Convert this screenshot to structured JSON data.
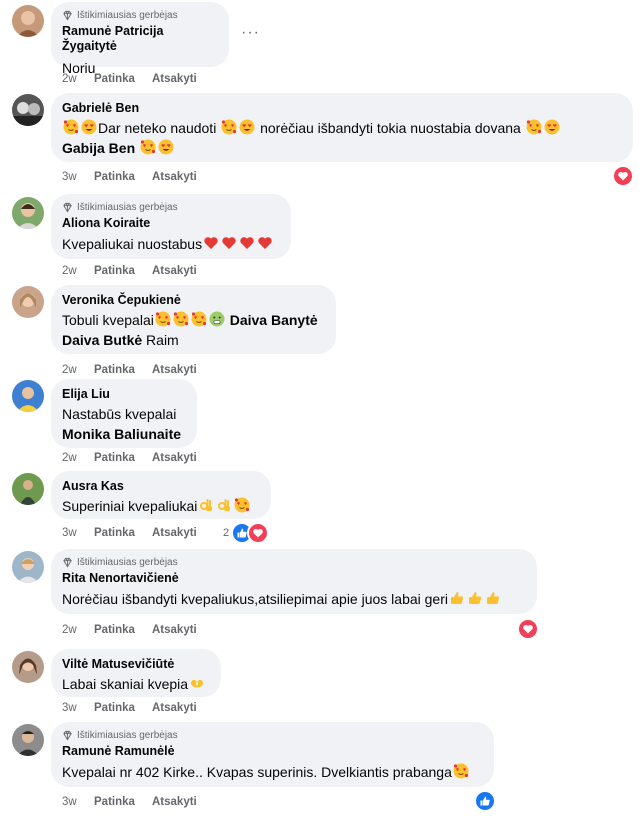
{
  "badge_label": "Ištikimiausias gerbėjas",
  "action_like": "Patinka",
  "action_reply": "Atsakyti",
  "more_icon": "···",
  "comments": [
    {
      "author": "Ramunė Patricija Žygaitytė",
      "badge": true,
      "line1": "Noriu",
      "time": "2w"
    },
    {
      "author": "Gabrielė Ben",
      "badge": false,
      "line1": "Dar neteko naudoti",
      "line1b": "norėčiau išbandyti tokia nuostabia dovana",
      "tag": "Gabija Ben",
      "time": "3w"
    },
    {
      "author": "Aliona Koiraite",
      "badge": true,
      "line1": "Kvepaliukai nuostabus",
      "time": "2w"
    },
    {
      "author": "Veronika Čepukienė",
      "badge": false,
      "line1": "Tobuli kvepalai",
      "tag1": "Daiva Banytė",
      "tag2": "Daiva Butkė",
      "line2rest": "Raim",
      "time": "2w"
    },
    {
      "author": "Elija Liu",
      "badge": false,
      "line1": "Nastabūs kvepalai",
      "tag": "Monika Baliunaite",
      "time": "2w"
    },
    {
      "author": "Ausra Kas",
      "badge": false,
      "line1": "Superiniai kvepaliukai",
      "time": "3w",
      "reaction_count": "2"
    },
    {
      "author": "Rita Nenortavičienė",
      "badge": true,
      "line1": "Norėčiau išbandyti kvepaliukus,atsiliepimai apie juos labai geri",
      "time": "2w"
    },
    {
      "author": "Viltė Matusevičiūtė",
      "badge": false,
      "line1": "Labai skaniai kvepia",
      "time": "3w"
    },
    {
      "author": "Ramunė Ramunėlė",
      "badge": true,
      "line1": "Kvepalai nr 402 Kirke.. Kvapas superinis. Dvelkiantis prabanga",
      "time": "3w"
    }
  ],
  "colors": {
    "bubble": "#f0f2f5",
    "meta": "#65676b",
    "heart": "#f33e58",
    "like": "#1877f2"
  }
}
